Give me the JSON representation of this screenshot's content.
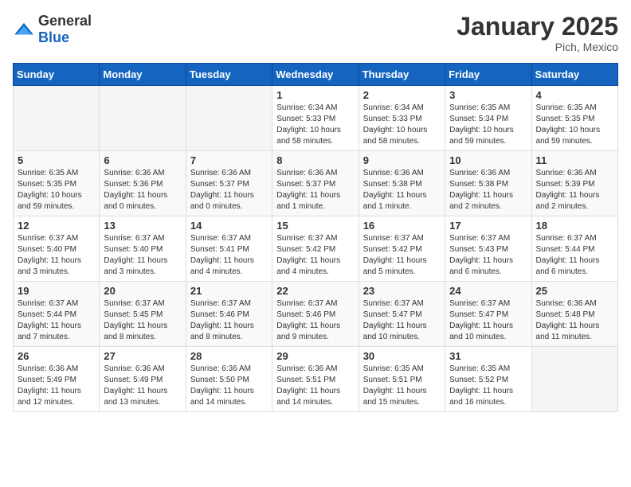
{
  "header": {
    "logo_general": "General",
    "logo_blue": "Blue",
    "month_year": "January 2025",
    "location": "Pich, Mexico"
  },
  "weekdays": [
    "Sunday",
    "Monday",
    "Tuesday",
    "Wednesday",
    "Thursday",
    "Friday",
    "Saturday"
  ],
  "weeks": [
    [
      {
        "day": "",
        "info": ""
      },
      {
        "day": "",
        "info": ""
      },
      {
        "day": "",
        "info": ""
      },
      {
        "day": "1",
        "info": "Sunrise: 6:34 AM\nSunset: 5:33 PM\nDaylight: 10 hours\nand 58 minutes."
      },
      {
        "day": "2",
        "info": "Sunrise: 6:34 AM\nSunset: 5:33 PM\nDaylight: 10 hours\nand 58 minutes."
      },
      {
        "day": "3",
        "info": "Sunrise: 6:35 AM\nSunset: 5:34 PM\nDaylight: 10 hours\nand 59 minutes."
      },
      {
        "day": "4",
        "info": "Sunrise: 6:35 AM\nSunset: 5:35 PM\nDaylight: 10 hours\nand 59 minutes."
      }
    ],
    [
      {
        "day": "5",
        "info": "Sunrise: 6:35 AM\nSunset: 5:35 PM\nDaylight: 10 hours\nand 59 minutes."
      },
      {
        "day": "6",
        "info": "Sunrise: 6:36 AM\nSunset: 5:36 PM\nDaylight: 11 hours\nand 0 minutes."
      },
      {
        "day": "7",
        "info": "Sunrise: 6:36 AM\nSunset: 5:37 PM\nDaylight: 11 hours\nand 0 minutes."
      },
      {
        "day": "8",
        "info": "Sunrise: 6:36 AM\nSunset: 5:37 PM\nDaylight: 11 hours\nand 1 minute."
      },
      {
        "day": "9",
        "info": "Sunrise: 6:36 AM\nSunset: 5:38 PM\nDaylight: 11 hours\nand 1 minute."
      },
      {
        "day": "10",
        "info": "Sunrise: 6:36 AM\nSunset: 5:38 PM\nDaylight: 11 hours\nand 2 minutes."
      },
      {
        "day": "11",
        "info": "Sunrise: 6:36 AM\nSunset: 5:39 PM\nDaylight: 11 hours\nand 2 minutes."
      }
    ],
    [
      {
        "day": "12",
        "info": "Sunrise: 6:37 AM\nSunset: 5:40 PM\nDaylight: 11 hours\nand 3 minutes."
      },
      {
        "day": "13",
        "info": "Sunrise: 6:37 AM\nSunset: 5:40 PM\nDaylight: 11 hours\nand 3 minutes."
      },
      {
        "day": "14",
        "info": "Sunrise: 6:37 AM\nSunset: 5:41 PM\nDaylight: 11 hours\nand 4 minutes."
      },
      {
        "day": "15",
        "info": "Sunrise: 6:37 AM\nSunset: 5:42 PM\nDaylight: 11 hours\nand 4 minutes."
      },
      {
        "day": "16",
        "info": "Sunrise: 6:37 AM\nSunset: 5:42 PM\nDaylight: 11 hours\nand 5 minutes."
      },
      {
        "day": "17",
        "info": "Sunrise: 6:37 AM\nSunset: 5:43 PM\nDaylight: 11 hours\nand 6 minutes."
      },
      {
        "day": "18",
        "info": "Sunrise: 6:37 AM\nSunset: 5:44 PM\nDaylight: 11 hours\nand 6 minutes."
      }
    ],
    [
      {
        "day": "19",
        "info": "Sunrise: 6:37 AM\nSunset: 5:44 PM\nDaylight: 11 hours\nand 7 minutes."
      },
      {
        "day": "20",
        "info": "Sunrise: 6:37 AM\nSunset: 5:45 PM\nDaylight: 11 hours\nand 8 minutes."
      },
      {
        "day": "21",
        "info": "Sunrise: 6:37 AM\nSunset: 5:46 PM\nDaylight: 11 hours\nand 8 minutes."
      },
      {
        "day": "22",
        "info": "Sunrise: 6:37 AM\nSunset: 5:46 PM\nDaylight: 11 hours\nand 9 minutes."
      },
      {
        "day": "23",
        "info": "Sunrise: 6:37 AM\nSunset: 5:47 PM\nDaylight: 11 hours\nand 10 minutes."
      },
      {
        "day": "24",
        "info": "Sunrise: 6:37 AM\nSunset: 5:47 PM\nDaylight: 11 hours\nand 10 minutes."
      },
      {
        "day": "25",
        "info": "Sunrise: 6:36 AM\nSunset: 5:48 PM\nDaylight: 11 hours\nand 11 minutes."
      }
    ],
    [
      {
        "day": "26",
        "info": "Sunrise: 6:36 AM\nSunset: 5:49 PM\nDaylight: 11 hours\nand 12 minutes."
      },
      {
        "day": "27",
        "info": "Sunrise: 6:36 AM\nSunset: 5:49 PM\nDaylight: 11 hours\nand 13 minutes."
      },
      {
        "day": "28",
        "info": "Sunrise: 6:36 AM\nSunset: 5:50 PM\nDaylight: 11 hours\nand 14 minutes."
      },
      {
        "day": "29",
        "info": "Sunrise: 6:36 AM\nSunset: 5:51 PM\nDaylight: 11 hours\nand 14 minutes."
      },
      {
        "day": "30",
        "info": "Sunrise: 6:35 AM\nSunset: 5:51 PM\nDaylight: 11 hours\nand 15 minutes."
      },
      {
        "day": "31",
        "info": "Sunrise: 6:35 AM\nSunset: 5:52 PM\nDaylight: 11 hours\nand 16 minutes."
      },
      {
        "day": "",
        "info": ""
      }
    ]
  ]
}
